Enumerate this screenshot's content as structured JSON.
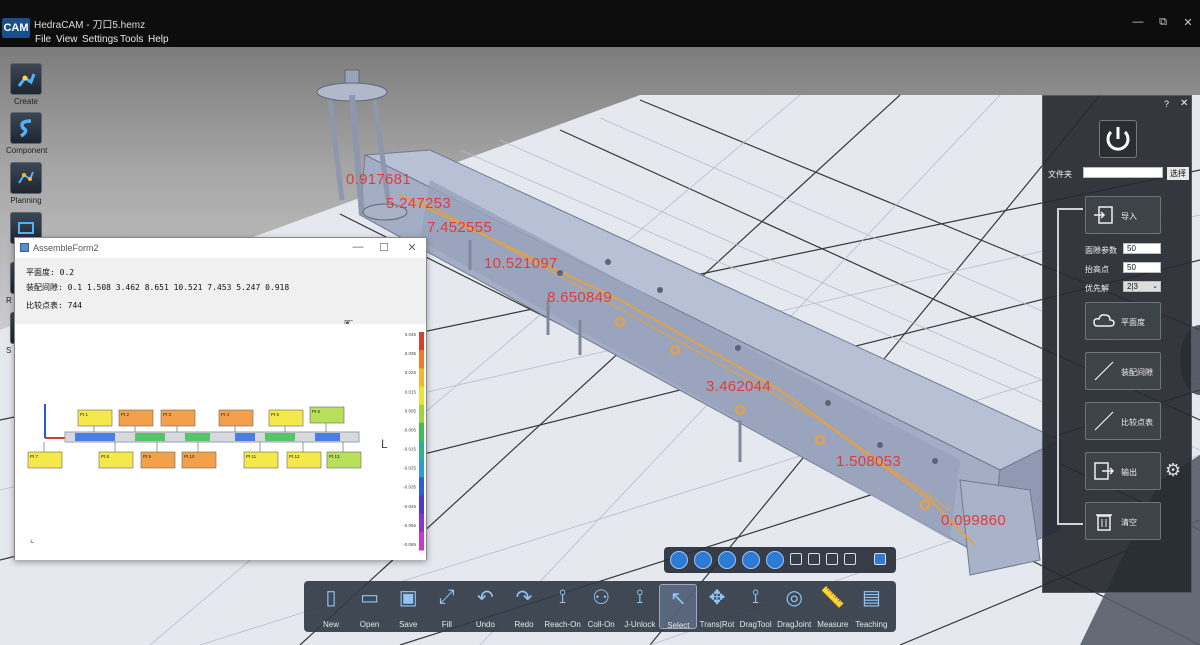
{
  "window": {
    "title": "HedraCAM - 刀口5.hemz",
    "logo_text": "CAM",
    "minimize_glyph": "—",
    "restore_glyph": "⧉",
    "close_glyph": "✕"
  },
  "menu": {
    "items": [
      "File",
      "View",
      "Settings",
      "Tools",
      "Help"
    ]
  },
  "left_toolbar": {
    "items": [
      {
        "label": "Create",
        "icon": "robot-arm-icon"
      },
      {
        "label": "Component",
        "icon": "component-s-icon"
      },
      {
        "label": "Planning",
        "icon": "planning-icon"
      },
      {
        "label": "",
        "icon": "module-icon"
      },
      {
        "label": "R",
        "icon": "robot-icon"
      },
      {
        "label": "S",
        "icon": "simulation-icon"
      }
    ]
  },
  "measurements": [
    {
      "value": "0.917681"
    },
    {
      "value": "5.247253"
    },
    {
      "value": "7.452555"
    },
    {
      "value": "10.521097"
    },
    {
      "value": "8.650849"
    },
    {
      "value": "3.462044"
    },
    {
      "value": "1.508053"
    },
    {
      "value": "0.099860"
    }
  ],
  "assemble_form": {
    "title": "AssembleForm2",
    "flatness_line": "平面度: 0.2",
    "gap_line": "装配间隙:  0.1 1.508 3.462 8.651 10.521 7.453 5.247 0.918",
    "compare_line": "比较点表: 744",
    "colorbar_ticks": [
      "0.045",
      "0.035",
      "0.025",
      "0.015",
      "0.005",
      "-0.005",
      "-0.015",
      "-0.025",
      "-0.035",
      "-0.045",
      "-0.055",
      "-0.065"
    ],
    "colorbar_colors": [
      "#d9402b",
      "#ef7b2b",
      "#f4b531",
      "#e8e43a",
      "#9ed43c",
      "#3fbf52",
      "#2fb08d",
      "#2d9fcd",
      "#2c5fd0",
      "#5038c7",
      "#8c34c3",
      "#c63dc4"
    ],
    "point_labels_top": [
      "Pt 1",
      "Pt 2",
      "Pt 3",
      "Pt 4",
      "Pt 5",
      "Pt 6"
    ],
    "point_labels_bottom": [
      "Pt 7",
      "Pt 8",
      "Pt 9",
      "Pt 10",
      "Pt 11",
      "Pt 12",
      "Pt 13"
    ]
  },
  "bottom_toolbar": {
    "items": [
      {
        "label": "New",
        "icon": "new-file-icon"
      },
      {
        "label": "Open",
        "icon": "open-folder-icon"
      },
      {
        "label": "Save",
        "icon": "save-icon"
      },
      {
        "label": "Fill",
        "icon": "fill-icon"
      },
      {
        "label": "Undo",
        "icon": "undo-icon"
      },
      {
        "label": "Redo",
        "icon": "redo-icon"
      },
      {
        "label": "Reach-On",
        "icon": "reach-icon"
      },
      {
        "label": "Coll-On",
        "icon": "collision-icon"
      },
      {
        "label": "J-Unlock",
        "icon": "joint-unlock-icon"
      },
      {
        "label": "Select",
        "icon": "select-cursor-icon"
      },
      {
        "label": "Trans|Rot",
        "icon": "transform-icon"
      },
      {
        "label": "DragTool",
        "icon": "drag-tool-icon"
      },
      {
        "label": "DragJoint",
        "icon": "drag-joint-icon"
      },
      {
        "label": "Measure",
        "icon": "ruler-icon"
      },
      {
        "label": "Teaching",
        "icon": "teaching-icon"
      }
    ],
    "active_index": 9
  },
  "play_bar": {
    "buttons": [
      "play-icon",
      "stop-icon",
      "view-cube-icon",
      "clock-icon",
      "orbit-icon"
    ]
  },
  "right_panel": {
    "help_glyph": "?",
    "close_glyph": "✕",
    "folder_label": "文件夹",
    "folder_value": "",
    "select_button": "选择",
    "import_button": "导入",
    "gap_param_label": "面隙参数",
    "gap_param_value": "50",
    "lift_label": "抬高点",
    "lift_value": "50",
    "priority_label": "优先解",
    "priority_value": "2|3",
    "flatness_button": "平面度",
    "assembly_gap_button": "装配间隙",
    "compare_button": "比较点表",
    "export_button": "输出",
    "clear_button": "清空"
  },
  "colors": {
    "measure_red": "#e23b3b",
    "path_orange": "#f0a030",
    "panel_bg": "#262a30",
    "toolbar_bg": "#323a46"
  }
}
